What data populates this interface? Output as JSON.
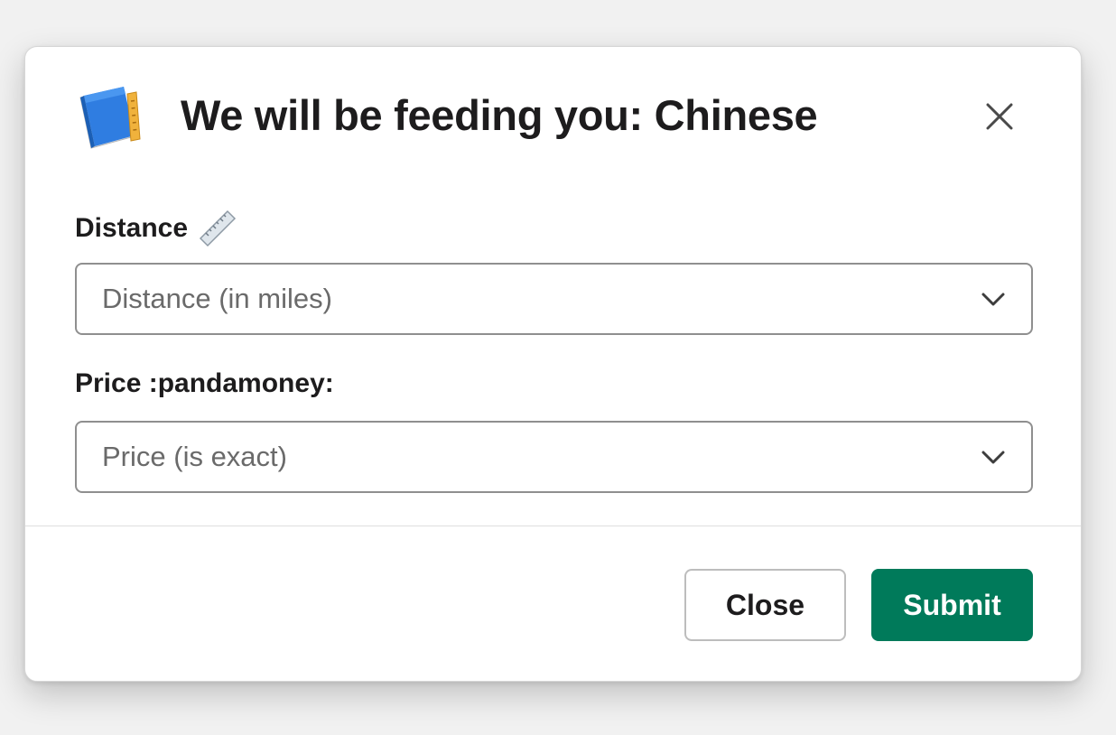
{
  "modal": {
    "title": "We will be feeding you: Chinese",
    "app_icon": "notebook-ruler-icon",
    "close_icon": "close-icon"
  },
  "form": {
    "fields": [
      {
        "label": "Distance",
        "label_icon": "straight-ruler-icon",
        "placeholder": "Distance (in miles)",
        "dropdown_icon": "chevron-down-icon"
      },
      {
        "label": "Price :pandamoney:",
        "placeholder": "Price (is exact)",
        "dropdown_icon": "chevron-down-icon"
      }
    ]
  },
  "footer": {
    "close_label": "Close",
    "submit_label": "Submit"
  },
  "colors": {
    "primary": "#007a5a",
    "text": "#1d1c1d",
    "placeholder": "#6a6a6a",
    "border": "#8f8f8f"
  }
}
